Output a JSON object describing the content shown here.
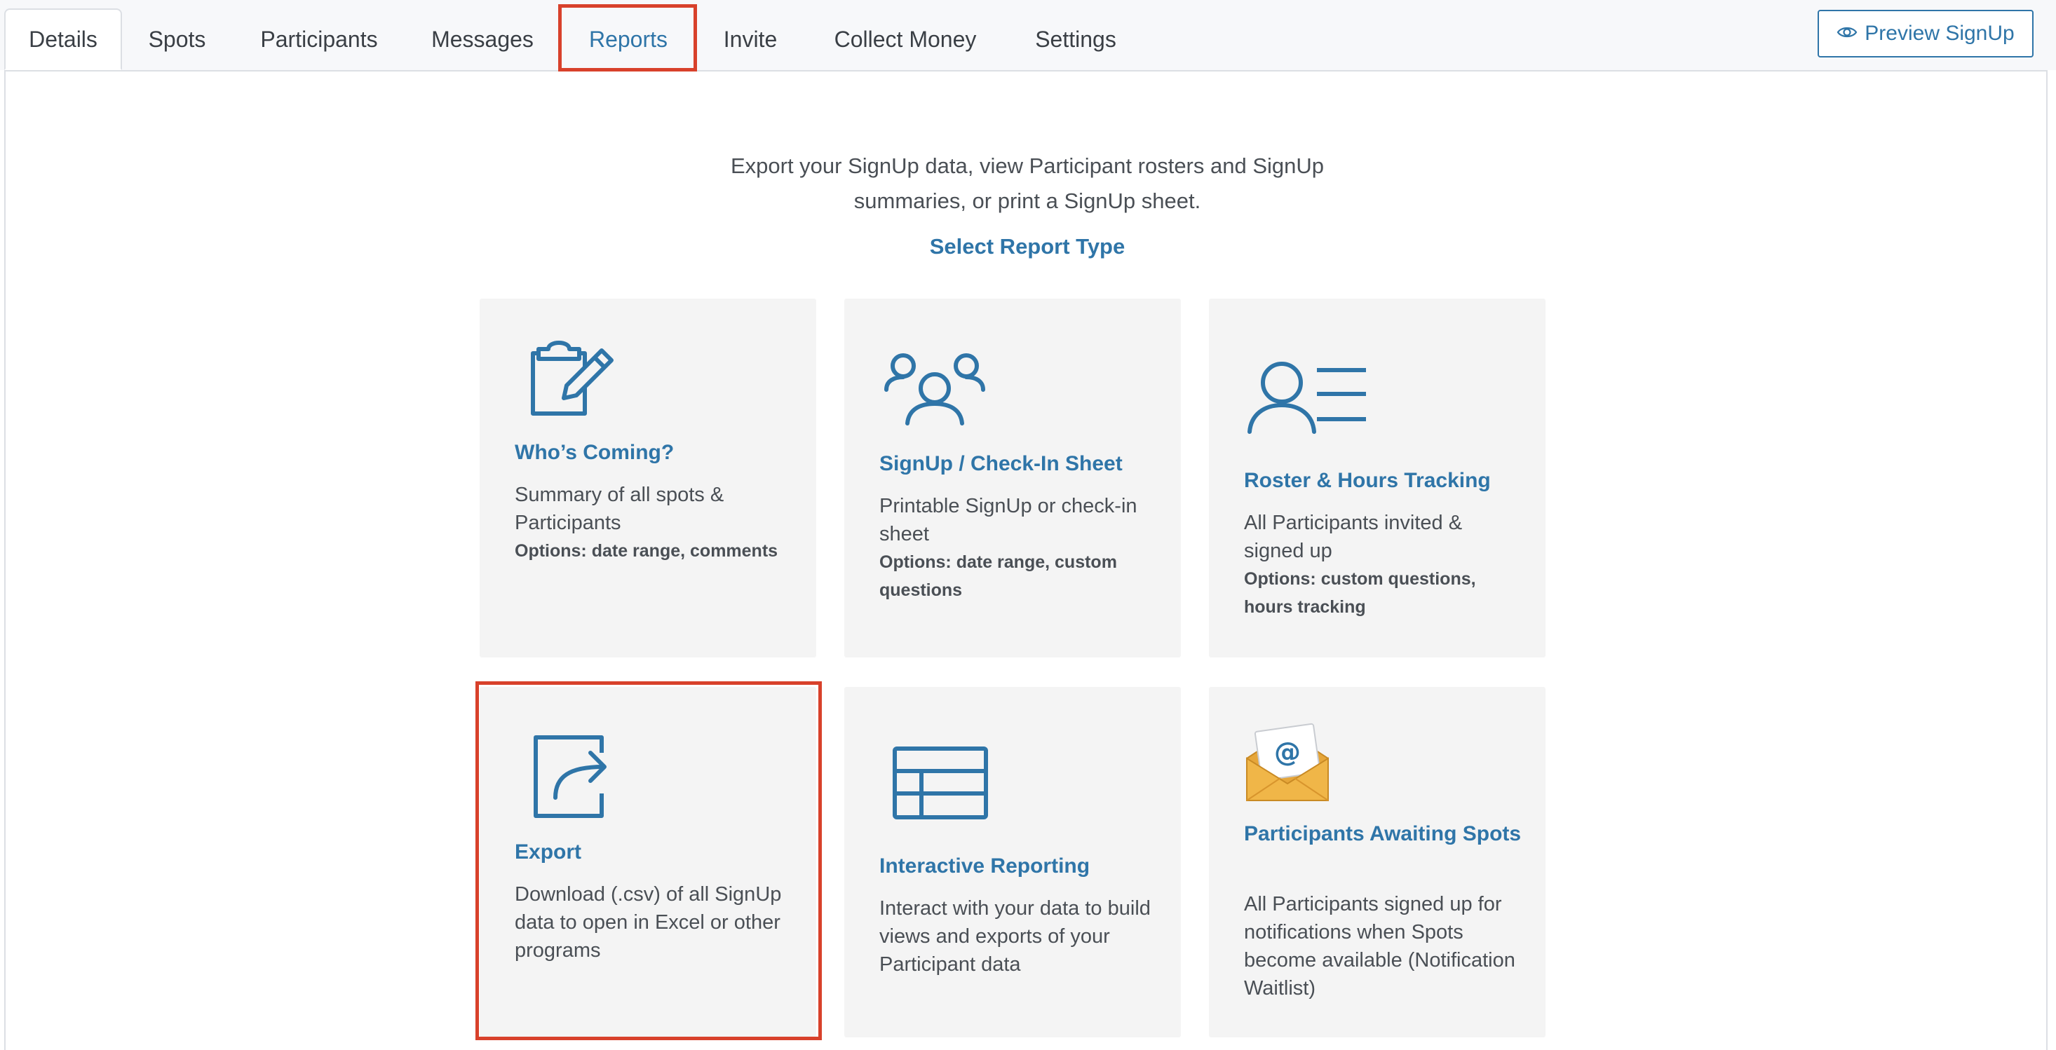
{
  "tabs": [
    {
      "label": "Details"
    },
    {
      "label": "Spots"
    },
    {
      "label": "Participants"
    },
    {
      "label": "Messages"
    },
    {
      "label": "Reports"
    },
    {
      "label": "Invite"
    },
    {
      "label": "Collect Money"
    },
    {
      "label": "Settings"
    }
  ],
  "active_tab": "Details",
  "preview_button": {
    "label": "Preview SignUp",
    "icon": "eye-icon"
  },
  "intro": {
    "line1": "Export your SignUp data, view Participant rosters and SignUp",
    "line2": "summaries, or print a SignUp sheet.",
    "select_title": "Select Report Type"
  },
  "cards": [
    {
      "title": "Who’s Coming?",
      "desc": "Summary of all spots & Participants",
      "options": "Options: date range, comments",
      "icon": "clipboard-edit-icon"
    },
    {
      "title": "SignUp / Check-In Sheet",
      "desc": "Printable SignUp or check-in sheet",
      "options": "Options: date range, custom questions",
      "icon": "group-icon"
    },
    {
      "title": "Roster & Hours Tracking",
      "desc": "All Participants invited & signed up",
      "options": "Options: custom questions, hours tracking",
      "icon": "roster-list-icon"
    },
    {
      "title": "Export",
      "desc": "Download (.csv) of all SignUp data to open in Excel or other programs",
      "options": "",
      "icon": "export-share-icon"
    },
    {
      "title": "Interactive Reporting",
      "desc": "Interact with your data to build views and exports of your Participant data",
      "options": "",
      "icon": "table-icon"
    },
    {
      "title": "Participants Awaiting Spots",
      "desc": "All Participants signed up for notifications when Spots become available (Notification Waitlist)",
      "options": "",
      "icon": "envelope-at-icon"
    }
  ],
  "colors": {
    "accent": "#2f75a8",
    "highlight": "#d8412b",
    "card_bg": "#f4f4f4"
  }
}
